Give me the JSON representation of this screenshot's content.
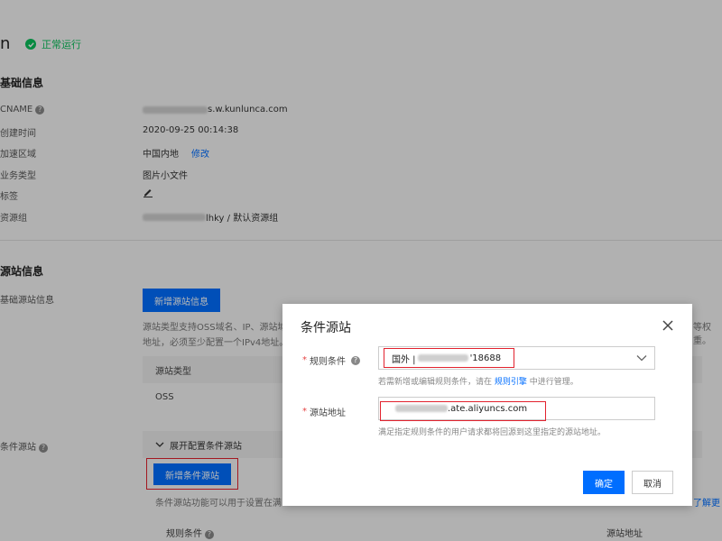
{
  "header": {
    "title_fragment": "n",
    "status": "正常运行"
  },
  "basic_info": {
    "section_title": "基础信息",
    "rows": [
      {
        "label": "CNAME",
        "value": "s.w.kunlunca.com"
      },
      {
        "label": "创建时间",
        "value": "2020-09-25 00:14:38"
      },
      {
        "label": "加速区域",
        "value": "中国内地",
        "action": "修改"
      },
      {
        "label": "业务类型",
        "value": "图片小文件"
      },
      {
        "label": "标签",
        "value": ""
      },
      {
        "label": "资源组",
        "value": "lhky / 默认资源组"
      }
    ]
  },
  "origin_info": {
    "section_title": "源站信息",
    "basic_label": "基础源站信息",
    "add_button": "新增源站信息",
    "desc_line1": "源站类型支持OSS域名、IP、源站域",
    "desc_line1_right": "等权重。",
    "desc_line2": "地址，必须至少配置一个IPv4地址。",
    "table_header": "源站类型",
    "table_cell": "OSS",
    "conditional_label": "条件源站",
    "expand_label": "展开配置条件源站",
    "add_conditional_button": "新增条件源站",
    "conditional_desc": "条件源站功能可以用于设置在满",
    "learn_more": "了解更",
    "bottom_col_left": "规则条件",
    "bottom_col_right": "源站地址"
  },
  "modal": {
    "title": "条件源站",
    "rule_label": "规则条件",
    "rule_value_prefix": "国外 |",
    "rule_value_suffix": "'18688",
    "rule_hint_before": "若需新增或编辑规则条件，请在",
    "rule_hint_link": "规则引擎",
    "rule_hint_after": "中进行管理。",
    "origin_label": "源站地址",
    "origin_value": ".ate.aliyuncs.com",
    "origin_hint": "满足指定规则条件的用户请求都将回源到这里指定的源站地址。",
    "confirm": "确定",
    "cancel": "取消"
  },
  "colors": {
    "primary": "#006eff",
    "status_green": "#0abf5b",
    "highlight_red": "#e2222e"
  }
}
